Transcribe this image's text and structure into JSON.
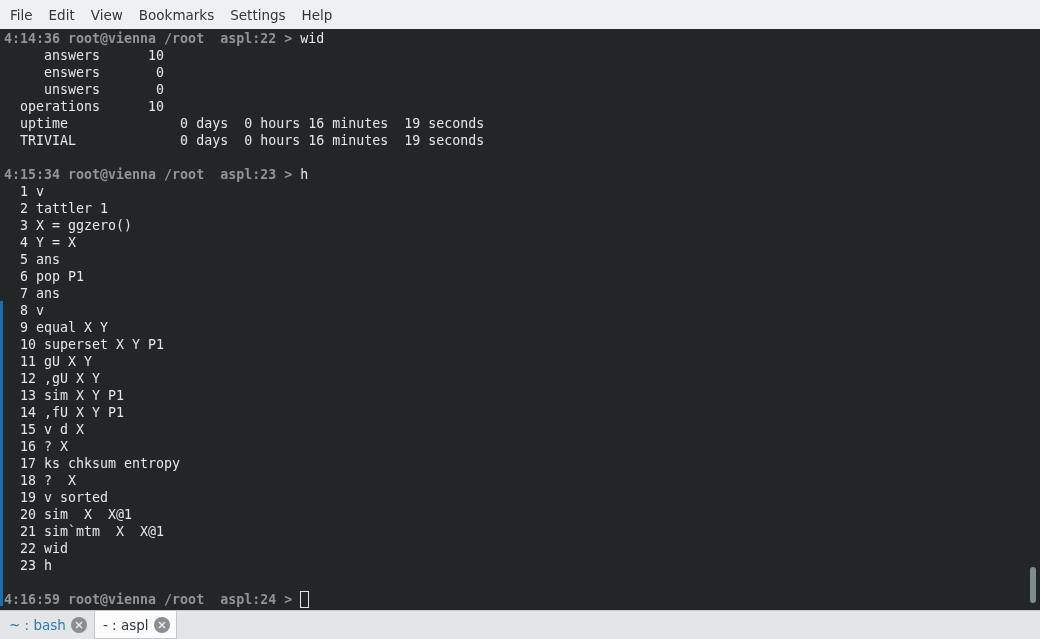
{
  "menu": [
    "File",
    "Edit",
    "View",
    "Bookmarks",
    "Settings",
    "Help"
  ],
  "lines": [
    {
      "kind": "prompt",
      "prompt": "4:14:36 root@vienna /root  aspl:22 >",
      "command": "wid"
    },
    {
      "kind": "output",
      "text": "     answers      10"
    },
    {
      "kind": "output",
      "text": "     enswers       0"
    },
    {
      "kind": "output",
      "text": "     unswers       0"
    },
    {
      "kind": "output",
      "text": "  operations      10"
    },
    {
      "kind": "output",
      "text": "  uptime              0 days  0 hours 16 minutes  19 seconds"
    },
    {
      "kind": "output",
      "text": "  TRIVIAL             0 days  0 hours 16 minutes  19 seconds"
    },
    {
      "kind": "blank"
    },
    {
      "kind": "prompt",
      "prompt": "4:15:34 root@vienna /root  aspl:23 >",
      "command": "h"
    },
    {
      "kind": "output",
      "text": "  1 v"
    },
    {
      "kind": "output",
      "text": "  2 tattler 1"
    },
    {
      "kind": "output",
      "text": "  3 X = ggzero()"
    },
    {
      "kind": "output",
      "text": "  4 Y = X"
    },
    {
      "kind": "output",
      "text": "  5 ans"
    },
    {
      "kind": "output",
      "text": "  6 pop P1"
    },
    {
      "kind": "output",
      "text": "  7 ans"
    },
    {
      "kind": "output",
      "text": "  8 v"
    },
    {
      "kind": "output",
      "text": "  9 equal X Y"
    },
    {
      "kind": "output",
      "text": "  10 superset X Y P1"
    },
    {
      "kind": "output",
      "text": "  11 gU X Y"
    },
    {
      "kind": "output",
      "text": "  12 ,gU X Y"
    },
    {
      "kind": "output",
      "text": "  13 sim X Y P1"
    },
    {
      "kind": "output",
      "text": "  14 ,fU X Y P1"
    },
    {
      "kind": "output",
      "text": "  15 v d X"
    },
    {
      "kind": "output",
      "text": "  16 ? X"
    },
    {
      "kind": "output",
      "text": "  17 ks chksum entropy"
    },
    {
      "kind": "output",
      "text": "  18 ?  X"
    },
    {
      "kind": "output",
      "text": "  19 v sorted"
    },
    {
      "kind": "output",
      "text": "  20 sim  X  X@1"
    },
    {
      "kind": "output",
      "text": "  21 sim`mtm  X  X@1"
    },
    {
      "kind": "output",
      "text": "  22 wid"
    },
    {
      "kind": "output",
      "text": "  23 h"
    },
    {
      "kind": "blank"
    },
    {
      "kind": "prompt",
      "prompt": "4:16:59 root@vienna /root  aspl:24 >",
      "cursor": true
    }
  ],
  "tabs": [
    {
      "label": "~ : bash",
      "selected": false
    },
    {
      "label": "- : aspl",
      "selected": true
    }
  ]
}
